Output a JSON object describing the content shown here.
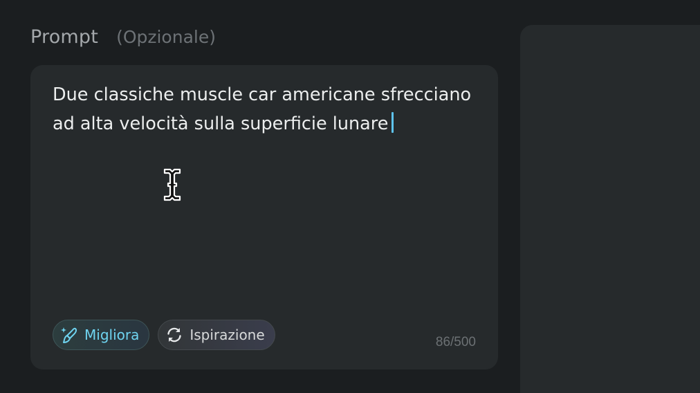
{
  "prompt": {
    "label": "Prompt",
    "optional_label": "(Opzionale)",
    "text": "Due classiche muscle car americane sfrecciano ad alta velocità sulla superficie lunare",
    "counter": "86/500"
  },
  "actions": {
    "improve": {
      "label": "Migliora",
      "icon": "magic-wand-icon"
    },
    "inspire": {
      "label": "Ispirazione",
      "icon": "refresh-icon"
    }
  },
  "colors": {
    "accent": "#5ec4ef",
    "background": "#1b1e20",
    "panel": "#262a2c"
  }
}
